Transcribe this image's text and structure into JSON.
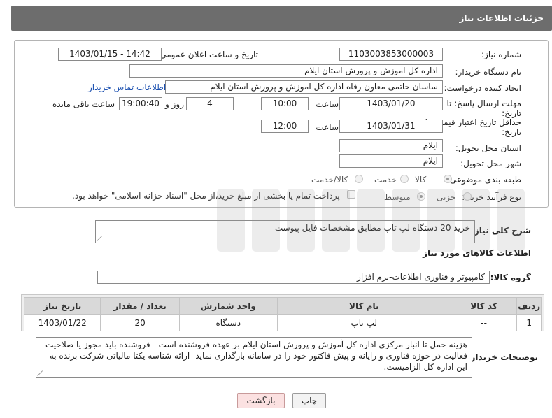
{
  "header": {
    "title": "جزئیات اطلاعات نیاز"
  },
  "need": {
    "number_label": "شماره نیاز:",
    "number": "1103003853000003",
    "announce_label": "تاریخ و ساعت اعلان عمومی:",
    "announce_value": "1403/01/15 - 14:42",
    "buyer_label": "نام دستگاه خریدار:",
    "buyer_value": "اداره کل اموزش و پرورش استان ایلام",
    "creator_label": "ایجاد کننده درخواست:",
    "creator_value": "ساسان حاتمی معاون رفاه  اداره کل اموزش و پرورش استان ایلام",
    "contact_link": "اطلاعات تماس خریدار",
    "deadline_label_1": "مهلت ارسال پاسخ: تا",
    "deadline_label_2": "تاریخ:",
    "deadline_date": "1403/01/20",
    "time_label": "ساعت",
    "deadline_time": "10:00",
    "days_value": "4",
    "days_label": "روز و",
    "remaining_time": "19:00:40",
    "remaining_label": "ساعت باقی مانده",
    "price_label_1": "حداقل تاریخ اعتبار قیمت: تا",
    "price_label_2": "تاریخ:",
    "price_date": "1403/01/31",
    "price_time": "12:00",
    "province_label": "استان محل تحویل:",
    "province_value": "ایلام",
    "city_label": "شهر محل تحویل:",
    "city_value": "ایلام",
    "category_label": "طبقه بندی موضوعی:",
    "category_options": {
      "goods": "کالا",
      "service": "خدمت",
      "goods_service": "کالا/خدمت"
    },
    "process_label": "نوع فرآیند خرید :",
    "process_options": {
      "small": "جزیی",
      "medium": "متوسط"
    },
    "payment_note": "پرداخت تمام یا بخشی از مبلغ خرید،از محل \"اسناد خزانه اسلامی\" خواهد بود."
  },
  "description": {
    "label": "شرح کلی نیاز:",
    "value": "خرید 20 دستگاه لپ تاپ مطابق مشخصات فایل پیوست"
  },
  "goods_info": {
    "title": "اطلاعات کالاهای مورد نیاز",
    "group_label": "گروه کالا:",
    "group_value": "کامپیوتر و فناوری اطلاعات-نرم افزار",
    "columns": [
      "ردیف",
      "کد کالا",
      "نام کالا",
      "واحد شمارش",
      "تعداد / مقدار",
      "تاریخ نیاز"
    ],
    "rows": [
      {
        "row": "1",
        "code": "--",
        "name": "لپ تاپ",
        "unit": "دستگاه",
        "qty": "20",
        "date": "1403/01/22"
      }
    ]
  },
  "buyer_notes": {
    "label": "توضیحات خریدار:",
    "value": "هزینه حمل تا انبار مرکزی اداره کل آموزش و پرورش استان ایلام بر عهده فروشنده است - فروشنده باید مجوز یا صلاحیت فعالیت در حوزه فناوری و رایانه و پیش فاکتور خود  را در سامانه بارگذاری نماید- ارائه شناسه یکتا مالیاتی شرکت برنده به این اداره کل الزامیست."
  },
  "buttons": {
    "print": "چاپ",
    "back": "بازگشت"
  },
  "colors": {
    "header_bg": "#6d6d6d",
    "link": "#1a4fb0",
    "back_btn": "#fbe1e1"
  }
}
